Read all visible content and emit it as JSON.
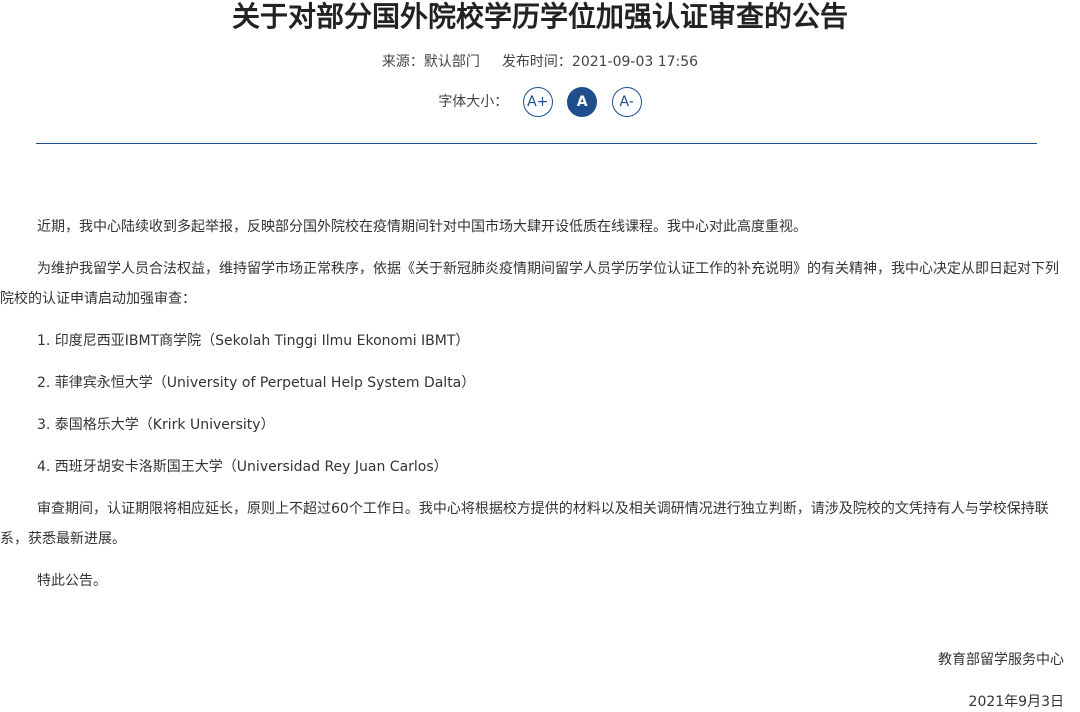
{
  "article": {
    "title": "关于对部分国外院校学历学位加强认证审查的公告",
    "source_label": "来源：",
    "source_value": "默认部门",
    "publish_label": "发布时间：",
    "publish_value": "2021-09-03 17:56"
  },
  "font_size": {
    "label": "字体大小：",
    "larger": "A+",
    "normal": "A",
    "smaller": "A-",
    "active": "A"
  },
  "body": {
    "paragraphs": [
      "近期，我中心陆续收到多起举报，反映部分国外院校在疫情期间针对中国市场大肆开设低质在线课程。我中心对此高度重视。",
      "为维护我留学人员合法权益，维持留学市场正常秩序，依据《关于新冠肺炎疫情期间留学人员学历学位认证工作的补充说明》的有关精神，我中心决定从即日起对下列院校的认证申请启动加强审查：",
      "1. 印度尼西亚IBMT商学院（Sekolah Tinggi Ilmu Ekonomi IBMT）",
      "2. 菲律宾永恒大学（University of Perpetual Help System Dalta）",
      "3. 泰国格乐大学（Krirk University）",
      "4. 西班牙胡安卡洛斯国王大学（Universidad Rey Juan Carlos）",
      "审查期间，认证期限将相应延长，原则上不超过60个工作日。我中心将根据校方提供的材料以及相关调研情况进行独立判断，请涉及院校的文凭持有人与学校保持联系，获悉最新进展。",
      "特此公告。"
    ]
  },
  "signature": {
    "organization": "教育部留学服务中心",
    "date": "2021年9月3日"
  },
  "colors": {
    "accent": "#1f4e8c",
    "text": "#333333",
    "title": "#222222"
  }
}
